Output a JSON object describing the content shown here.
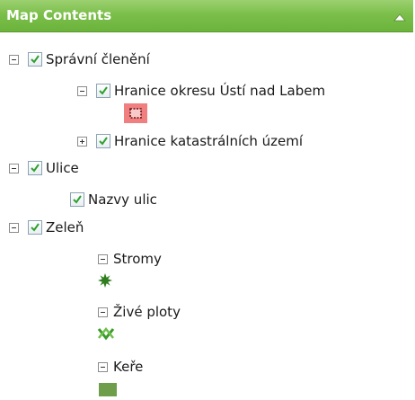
{
  "panel": {
    "title": "Map Contents",
    "colors": {
      "header_green": "#7bbf4a",
      "header_text": "#ffffff"
    }
  },
  "tree": {
    "admin": {
      "label": "Správní členění",
      "checked": true,
      "expanded": true
    },
    "district_boundary": {
      "label": "Hranice okresu Ústí nad Labem",
      "checked": true,
      "expanded": true,
      "legend_icon": "red-dashed-polygon-symbol"
    },
    "cadastral_boundary": {
      "label": "Hranice katastrálních území",
      "checked": true,
      "expanded": false
    },
    "streets": {
      "label": "Ulice",
      "checked": true,
      "expanded": true
    },
    "street_names": {
      "label": "Nazvy ulic",
      "checked": true
    },
    "greenery": {
      "label": "Zeleň",
      "checked": true,
      "expanded": true
    },
    "trees": {
      "label": "Stromy",
      "legend_icon": "tree-symbol"
    },
    "hedges": {
      "label": "Živé ploty",
      "legend_icon": "hedge-symbol"
    },
    "shrubs": {
      "label": "Keře",
      "legend_icon": "shrub-symbol"
    }
  }
}
